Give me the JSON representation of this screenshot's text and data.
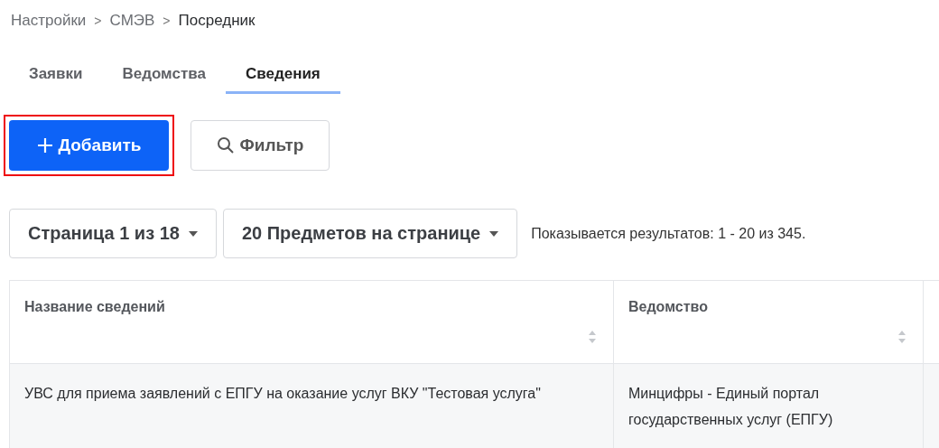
{
  "breadcrumb": [
    {
      "label": "Настройки",
      "current": false
    },
    {
      "label": "СМЭВ",
      "current": false
    },
    {
      "label": "Посредник",
      "current": true
    }
  ],
  "breadcrumb_separator": ">",
  "tabs": [
    {
      "label": "Заявки",
      "selected": false
    },
    {
      "label": "Ведомства",
      "selected": false
    },
    {
      "label": "Сведения",
      "selected": true
    }
  ],
  "toolbar": {
    "add_button": {
      "label": "Добавить",
      "highlighted": true
    },
    "filter_button": {
      "label": "Фильтр"
    }
  },
  "pagination": {
    "page_select": "Страница 1 из 18",
    "per_page_select": "20 Предметов на странице",
    "results": "Показывается результатов: 1 - 20 из 345."
  },
  "table": {
    "columns": [
      "Название сведений",
      "Ведомство"
    ],
    "rows": [
      [
        "УВС для приема заявлений с ЕПГУ на оказание услуг ВКУ \"Тестовая услуга\"",
        "Минцифры - Единый портал государственных услуг (ЕПГУ)"
      ]
    ]
  }
}
